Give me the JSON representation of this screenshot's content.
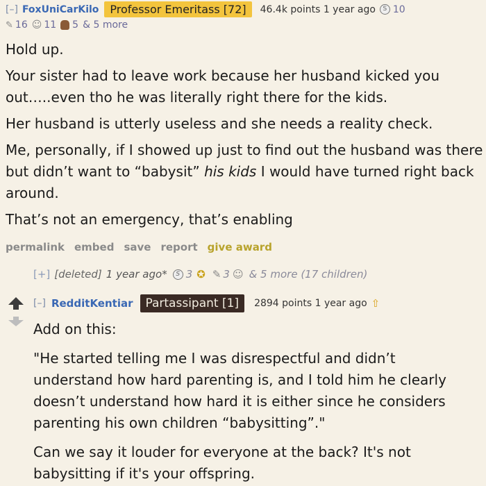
{
  "comment1": {
    "toggle": "[–]",
    "author": "FoxUniCarKilo",
    "flair": "Professor Emeritass [72]",
    "points": "46.4k points 1 year ago",
    "awards": [
      {
        "icon": "silver-coin-icon",
        "count": "10"
      },
      {
        "icon": "helpful-icon",
        "count": "16"
      },
      {
        "icon": "wholesome-icon",
        "count": "11"
      },
      {
        "icon": "beaver-icon",
        "count": "5"
      }
    ],
    "more": "& 5 more",
    "body": [
      "Hold up.",
      "Your sister had to leave work because her husband kicked you out…..even tho he was literally right there for the kids.",
      "Her husband is utterly useless and she needs a reality check.",
      "Me, personally, if I showed up just to find out the husband was there but didn’t want to “babysit”",
      "his kids",
      "I would have turned right back around.",
      "That’s not an emergency, that’s enabling"
    ],
    "actions": {
      "permalink": "permalink",
      "embed": "embed",
      "save": "save",
      "report": "report",
      "give_award": "give award"
    }
  },
  "collapsed": {
    "toggle": "[+]",
    "author": "[deleted]",
    "time": "1 year ago*",
    "award_counts": [
      "3",
      "3"
    ],
    "more": "& 5 more (17 children)"
  },
  "comment2": {
    "toggle": "[–]",
    "author": "RedditKentiar",
    "flair": "Partassipant [1]",
    "points": "2894 points 1 year ago",
    "body": [
      "Add on this:",
      "\"He started telling me I was disrespectful and didn’t understand how hard parenting is, and I told him he clearly doesn’t understand how hard it is either since he considers parenting his own children “babysitting”.\"",
      "Can we say it louder for everyone at the back? It's not babysitting if it's your offspring."
    ]
  },
  "colors": {
    "background": "#f6f1e6",
    "author": "#3a68b4",
    "flair_top": "#f3c43d",
    "flair_2": "#3a2a24",
    "give_award": "#b8a32c"
  }
}
